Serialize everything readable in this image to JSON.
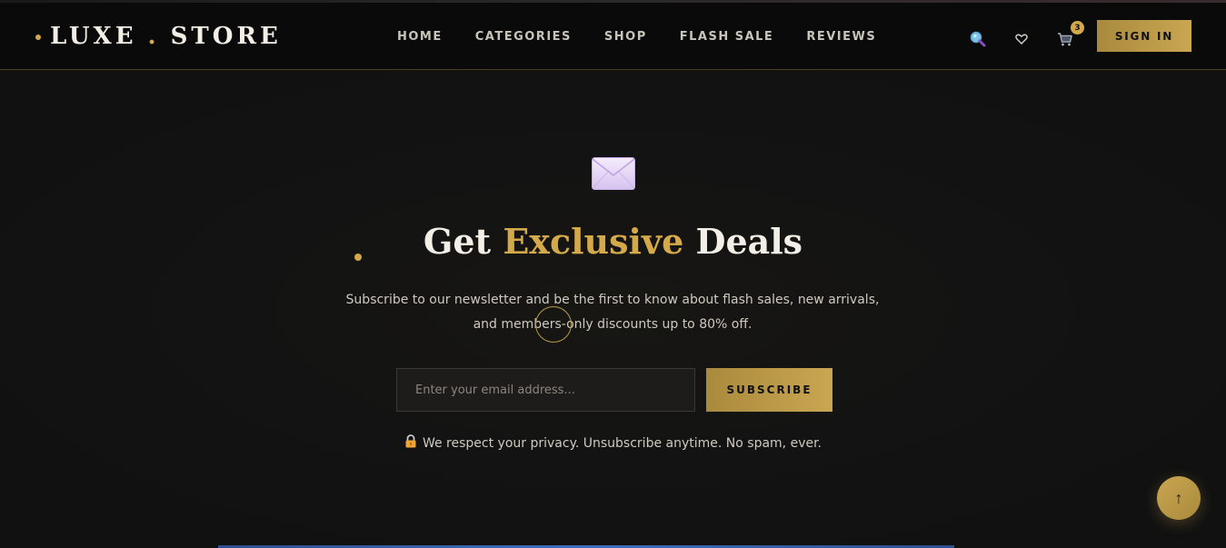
{
  "header": {
    "brand_left": "LUXE",
    "brand_sep": ".",
    "brand_right": "STORE",
    "nav": [
      {
        "label": "HOME"
      },
      {
        "label": "CATEGORIES"
      },
      {
        "label": "SHOP"
      },
      {
        "label": "FLASH SALE"
      },
      {
        "label": "REVIEWS"
      }
    ],
    "cart_count": "3",
    "signin_label": "SIGN IN",
    "icons": {
      "search": "search-icon",
      "wishlist": "heart-icon",
      "cart": "cart-icon"
    }
  },
  "newsletter": {
    "heading_before": "Get",
    "heading_accent": "Exclusive",
    "heading_after": "Deals",
    "subtitle": "Subscribe to our newsletter and be the first to know about flash sales, new arrivals, and members-only discounts up to 80% off.",
    "email_placeholder": "Enter your email address...",
    "subscribe_label": "SUBSCRIBE",
    "privacy_text": "We respect your privacy. Unsubscribe anytime. No spam, ever."
  },
  "scroll_top_label": "↑",
  "colors": {
    "accent": "#d4a94a",
    "background": "#111111",
    "header_bg": "#0a0a0a"
  }
}
